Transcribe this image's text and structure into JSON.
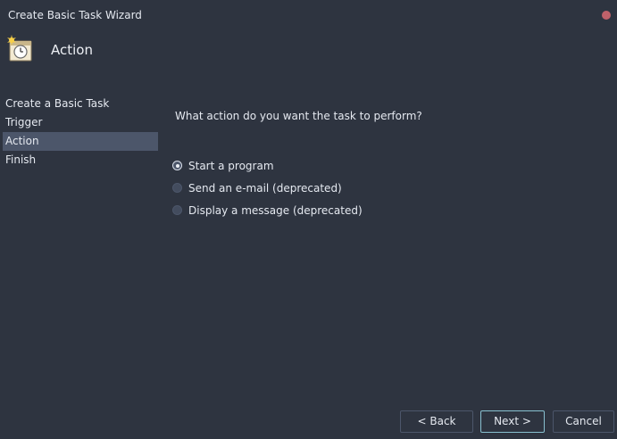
{
  "window": {
    "title": "Create Basic Task Wizard"
  },
  "header": {
    "title": "Action",
    "icon": "task-scheduler-icon"
  },
  "sidebar": {
    "items": [
      {
        "label": "Create a Basic Task",
        "active": false
      },
      {
        "label": "Trigger",
        "active": false
      },
      {
        "label": "Action",
        "active": true
      },
      {
        "label": "Finish",
        "active": false
      }
    ]
  },
  "main": {
    "question": "What action do you want the task to perform?",
    "options": [
      {
        "label": "Start a program",
        "selected": true
      },
      {
        "label": "Send an e-mail (deprecated)",
        "selected": false
      },
      {
        "label": "Display a message (deprecated)",
        "selected": false
      }
    ]
  },
  "buttons": {
    "back": "< Back",
    "next": "Next >",
    "cancel": "Cancel"
  },
  "colors": {
    "background": "#2e3440",
    "sidebar_active": "#4c566a",
    "close_button": "#bf616a",
    "primary_border": "#88c0d0"
  }
}
